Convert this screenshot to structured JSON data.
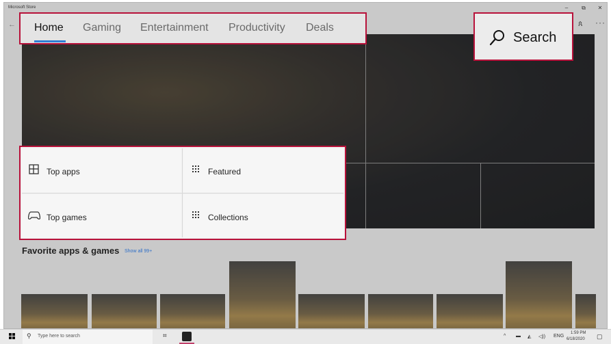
{
  "window": {
    "title": "Microsoft Store",
    "controls": {
      "minimize": "–",
      "restore": "⧉",
      "close": "✕"
    },
    "back_icon": "←"
  },
  "nav": {
    "tabs": [
      {
        "label": "Home"
      },
      {
        "label": "Gaming"
      },
      {
        "label": "Entertainment"
      },
      {
        "label": "Productivity"
      },
      {
        "label": "Deals"
      }
    ],
    "active_tab": "Home",
    "highlight_color": "#b8113a",
    "accent_color": "#2f7fd6"
  },
  "search": {
    "label": "Search",
    "icon": "search-icon"
  },
  "header_icons": {
    "account": "ጰ",
    "more": "···"
  },
  "categories": [
    {
      "label": "Top apps",
      "icon": "grid-apps-icon",
      "glyph": "⊞"
    },
    {
      "label": "Featured",
      "icon": "dots-grid-icon",
      "glyph": "⁞⁞⁞"
    },
    {
      "label": "Top games",
      "icon": "gamepad-icon",
      "glyph": "🎮"
    },
    {
      "label": "Collections",
      "icon": "dots-grid-icon",
      "glyph": "⁞⁞⁞"
    }
  ],
  "favorites": {
    "title": "Favorite apps & games",
    "link": "Show all 99+"
  },
  "taskbar": {
    "search_placeholder": "Type here to search",
    "search_icon": "⚲",
    "taskview_icon": "⌗",
    "tray": [
      "^",
      "▬",
      "◭",
      "◁))",
      "ENG"
    ],
    "time": "1:59 PM",
    "date": "6/18/2020",
    "notification_icon": "▢"
  }
}
